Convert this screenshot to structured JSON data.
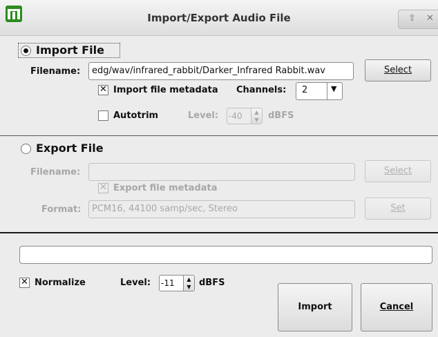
{
  "window": {
    "title": "Import/Export Audio File",
    "controls_up": "⇧",
    "controls_close": "✕"
  },
  "import": {
    "section_label": "Import File",
    "selected": true,
    "filename_label": "Filename:",
    "filename_value": "edg/wav/infrared_rabbit/Darker_Infrared Rabbit.wav",
    "select_label": "Select",
    "metadata_checked": true,
    "metadata_label": "Import file metadata",
    "channels_label": "Channels:",
    "channels_value": "2",
    "autotrim_checked": false,
    "autotrim_label": "Autotrim",
    "level_label": "Level:",
    "level_value": "-40",
    "level_unit": "dBFS"
  },
  "export": {
    "section_label": "Export File",
    "selected": false,
    "filename_label": "Filename:",
    "filename_value": "",
    "select_label": "Select",
    "metadata_checked": true,
    "metadata_label": "Export file metadata",
    "format_label": "Format:",
    "format_value": "PCM16, 44100 samp/sec, Stereo",
    "set_label": "Set"
  },
  "bottom": {
    "progress_value": "",
    "normalize_checked": true,
    "normalize_label": "Normalize",
    "level_label": "Level:",
    "level_value": "-11",
    "level_unit": "dBFS",
    "import_label": "Import",
    "cancel_label": "Cancel"
  },
  "icons": {
    "app": "app-logo-icon",
    "dropdown": "chevron-down-icon",
    "spin_up": "arrow-up-icon",
    "spin_down": "arrow-down-icon"
  }
}
